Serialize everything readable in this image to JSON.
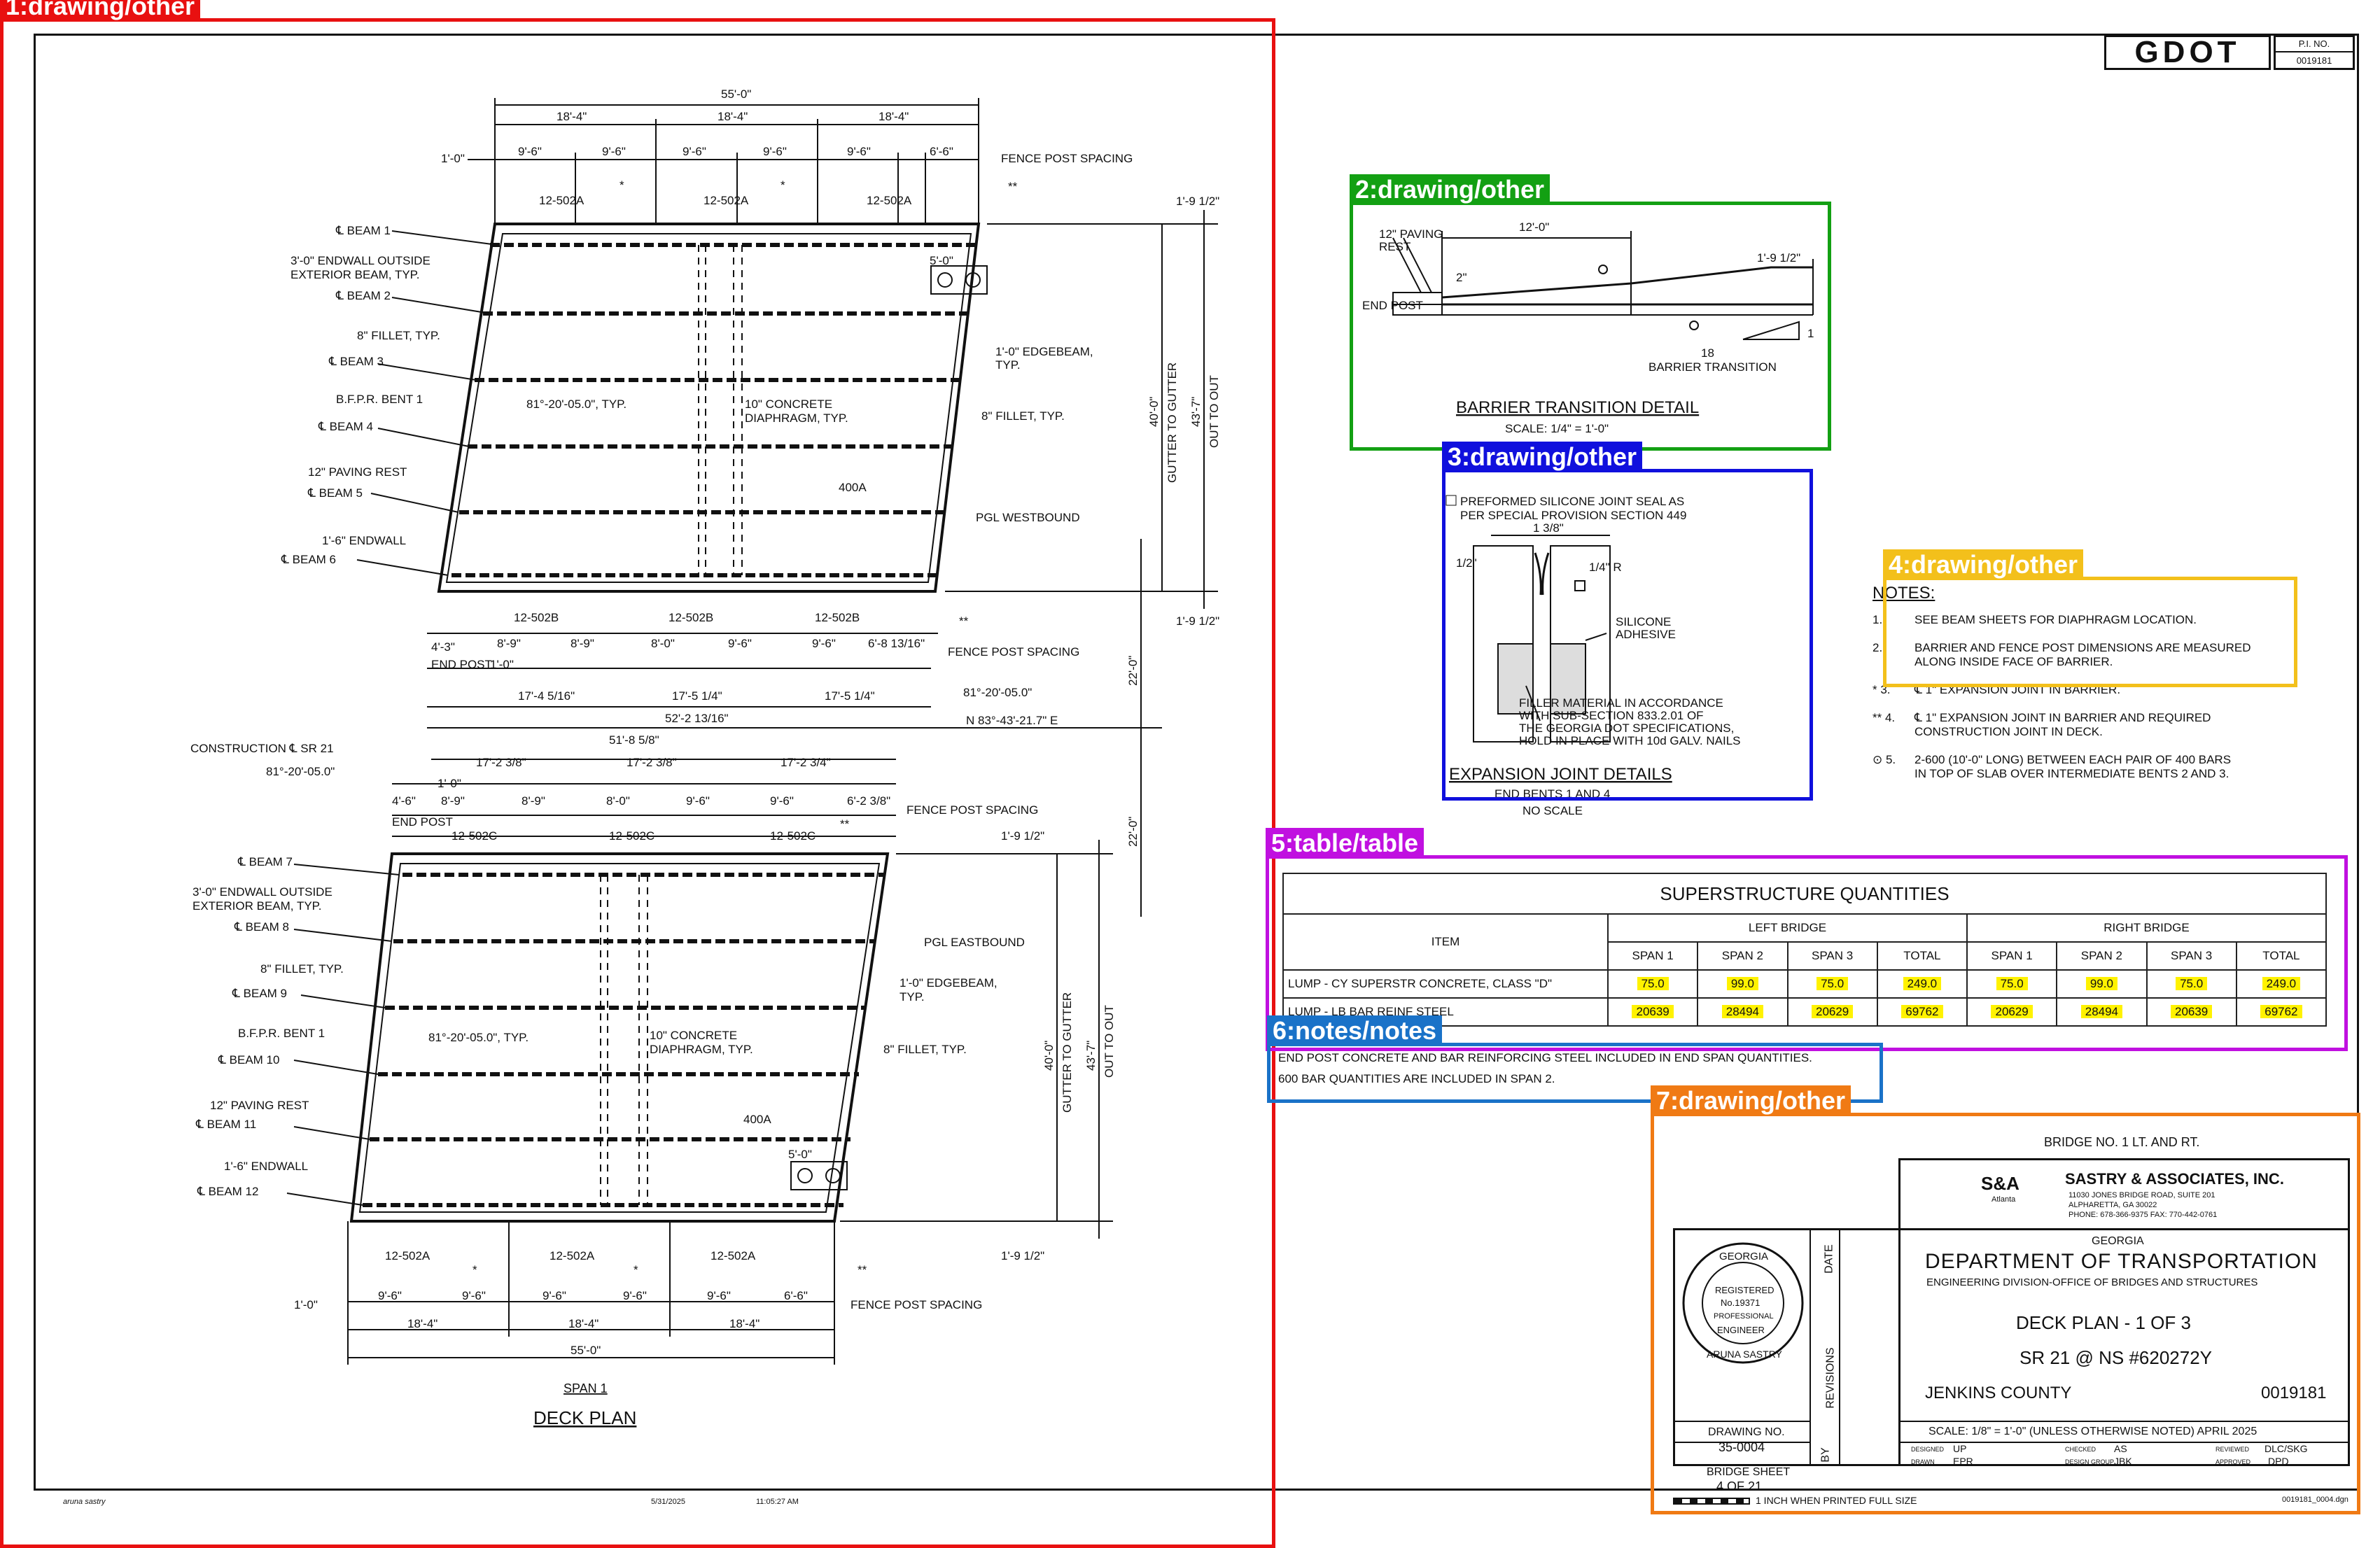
{
  "header": {
    "logo": "GDOT",
    "pi_label": "P.I. NO.",
    "pi_value": "0019181"
  },
  "annotations": [
    {
      "label": "1:drawing/other",
      "color": "#e81010"
    },
    {
      "label": "2:drawing/other",
      "color": "#13a013"
    },
    {
      "label": "3:drawing/other",
      "color": "#1010dd"
    },
    {
      "label": "4:drawing/other",
      "color": "#f3c01b"
    },
    {
      "label": "5:table/table",
      "color": "#c010e0"
    },
    {
      "label": "6:notes/notes",
      "color": "#1a72c8"
    },
    {
      "label": "7:drawing/other",
      "color": "#f07a14"
    }
  ],
  "deck_plan": {
    "title": "DECK PLAN",
    "span_label": "SPAN 1",
    "top_dims": {
      "overall": "55'-0\"",
      "segments": [
        "18'-4\"",
        "18'-4\"",
        "18'-4\""
      ],
      "posts": [
        "1'-0\"",
        "9'-6\"",
        "9'-6\"",
        "9'-6\"",
        "9'-6\"",
        "9'-6\"",
        "6'-6\""
      ],
      "fence_post_spacing": "FENCE POST SPACING",
      "bars": [
        "12-502A",
        "12-502A",
        "12-502A"
      ],
      "star": "*",
      "dstar": "**"
    },
    "left_bridge_labels": [
      "℄ BEAM 1",
      "3'-0\" ENDWALL OUTSIDE",
      "EXTERIOR BEAM, TYP.",
      "℄ BEAM 2",
      "8\" FILLET, TYP.",
      "℄ BEAM 3",
      "B.F.P.R. BENT 1",
      "℄ BEAM 4",
      "12\" PAVING REST",
      "℄ BEAM 5",
      "1'-6\" ENDWALL",
      "℄ BEAM 6"
    ],
    "right_bridge_labels": [
      "℄ BEAM 7",
      "3'-0\" ENDWALL OUTSIDE",
      "EXTERIOR BEAM, TYP.",
      "℄ BEAM 8",
      "8\" FILLET, TYP.",
      "℄ BEAM 9",
      "B.F.P.R. BENT 1",
      "℄ BEAM 10",
      "12\" PAVING REST",
      "℄ BEAM 11",
      "1'-6\" ENDWALL",
      "℄ BEAM 12"
    ],
    "inner_labels": [
      "81°-20'-05.0\", TYP.",
      "10\" CONCRETE",
      "DIAPHRAGM, TYP.",
      "400A",
      "1'-0\" EDGEBEAM,",
      "TYP.",
      "8\" FILLET, TYP."
    ],
    "right_dims": {
      "gutter": "40'-0\"",
      "gutter_label": "GUTTER TO GUTTER",
      "out": "43'-7\"",
      "out_label": "OUT TO OUT",
      "edge": "1'-9 1/2\"",
      "gap": "22'-0\""
    },
    "pgl_wb": "PGL WESTBOUND",
    "pgl_eb": "PGL EASTBOUND",
    "middle": {
      "bars_b": [
        "12-502B",
        "12-502B",
        "12-502B"
      ],
      "bars_c": [
        "12-502C",
        "12-502C",
        "12-502C"
      ],
      "end_post": "END POST",
      "lower_posts_wb": [
        "4'-3\"",
        "8'-9\"",
        "8'-9\"",
        "8'-0\"",
        "9'-6\"",
        "9'-6\"",
        "6'-8 13/16\""
      ],
      "lower_posts_eb": [
        "4'-6\"",
        "8'-9\"",
        "8'-9\"",
        "8'-0\"",
        "9'-6\"",
        "9'-6\"",
        "6'-2 3/8\""
      ],
      "spans_wb": [
        "17'-4 5/16\"",
        "17'-5 1/4\"",
        "17'-5 1/4\""
      ],
      "total_wb": "52'-2 13/16\"",
      "spans_eb": [
        "17'-2 3/8\"",
        "17'-2 3/8\"",
        "17'-2 3/4\""
      ],
      "total_eb": "51'-8 5/8\"",
      "one_foot": "1'-0\"",
      "skew": "81°-20'-05.0\"",
      "bearing": "N 83°-43'-21.7\" E",
      "construction": "CONSTRUCTION ℄ SR 21",
      "skew2": "81°-20'-05.0\""
    },
    "bottom_dims": {
      "overall": "55'-0\"",
      "segments": [
        "18'-4\"",
        "18'-4\"",
        "18'-4\""
      ],
      "posts": [
        "1'-0\"",
        "9'-6\"",
        "9'-6\"",
        "9'-6\"",
        "9'-6\"",
        "9'-6\"",
        "6'-6\""
      ],
      "bars": [
        "12-502A",
        "12-502A",
        "12-502A"
      ]
    },
    "marker": "5'-0\""
  },
  "barrier_detail": {
    "title": "BARRIER TRANSITION DETAIL",
    "scale": "SCALE: 1/4\" = 1'-0\"",
    "labels": [
      "12\" PAVING",
      "REST",
      "END POST",
      "2\"",
      "12'-0\"",
      "1'-9 1/2\"",
      "18",
      "1",
      "BARRIER TRANSITION"
    ]
  },
  "expansion_detail": {
    "title": "EXPANSION JOINT DETAILS",
    "sub": "END BENTS 1 AND 4",
    "scale": "NO SCALE",
    "note1": [
      "PREFORMED SILICONE JOINT SEAL AS",
      "PER SPECIAL PROVISION SECTION 449"
    ],
    "dims": [
      "1 3/8\"",
      "1/4\" R",
      "1/2\""
    ],
    "silicone": [
      "SILICONE",
      "ADHESIVE"
    ],
    "filler": [
      "FILLER MATERIAL IN ACCORDANCE",
      "WITH SUB-SECTION 833.2.01 OF",
      "THE GEORGIA DOT SPECIFICATIONS,",
      "HOLD IN PLACE WITH 10d GALV. NAILS"
    ]
  },
  "notes": {
    "title": "NOTES:",
    "items": [
      {
        "mark": "1.",
        "lines": [
          "SEE BEAM SHEETS FOR DIAPHRAGM LOCATION."
        ]
      },
      {
        "mark": "2.",
        "lines": [
          "BARRIER AND FENCE POST DIMENSIONS ARE MEASURED",
          "ALONG INSIDE FACE OF BARRIER."
        ]
      },
      {
        "mark": "* 3.",
        "lines": [
          "℄ 1\" EXPANSION JOINT IN BARRIER."
        ]
      },
      {
        "mark": "** 4.",
        "lines": [
          "℄ 1\" EXPANSION JOINT IN BARRIER AND REQUIRED",
          "CONSTRUCTION JOINT IN DECK."
        ]
      },
      {
        "mark": "⊙ 5.",
        "lines": [
          "2-600 (10'-0\" LONG) BETWEEN EACH PAIR OF 400 BARS",
          "IN TOP OF SLAB OVER INTERMEDIATE BENTS 2 AND 3."
        ]
      }
    ]
  },
  "quantities": {
    "title": "SUPERSTRUCTURE QUANTITIES",
    "item_header": "ITEM",
    "left_header": "LEFT BRIDGE",
    "right_header": "RIGHT BRIDGE",
    "cols": [
      "SPAN 1",
      "SPAN 2",
      "SPAN 3",
      "TOTAL",
      "SPAN 1",
      "SPAN 2",
      "SPAN 3",
      "TOTAL"
    ],
    "rows": [
      {
        "item": "LUMP - CY SUPERSTR CONCRETE, CLASS \"D\"",
        "values": [
          "75.0",
          "99.0",
          "75.0",
          "249.0",
          "75.0",
          "99.0",
          "75.0",
          "249.0"
        ]
      },
      {
        "item": "LUMP - LB BAR REINF STEEL",
        "values": [
          "20639",
          "28494",
          "20629",
          "69762",
          "20629",
          "28494",
          "20639",
          "69762"
        ]
      }
    ]
  },
  "footnotes": [
    "END POST CONCRETE AND BAR REINFORCING STEEL INCLUDED IN END SPAN QUANTITIES.",
    "600 BAR QUANTITIES ARE INCLUDED IN SPAN 2."
  ],
  "title_block": {
    "bridge": "BRIDGE NO. 1 LT. AND RT.",
    "firm_logo": "S&A",
    "firm_logo_sub": "Atlanta",
    "firm": "SASTRY & ASSOCIATES, INC.",
    "firm_addr": [
      "11030 JONES BRIDGE ROAD, SUITE 201",
      "ALPHARETTA, GA 30022",
      "PHONE: 678-366-9375    FAX: 770-442-0761"
    ],
    "state": "GEORGIA",
    "dept": "DEPARTMENT OF TRANSPORTATION",
    "division": "ENGINEERING DIVISION-OFFICE OF BRIDGES AND STRUCTURES",
    "sheet_title": "DECK PLAN - 1 OF 3",
    "route": "SR 21 @ NS #620272Y",
    "county": "JENKINS COUNTY",
    "pi": "0019181",
    "scale": "SCALE: 1/8\" = 1'-0\" (UNLESS OTHERWISE NOTED)  APRIL 2025",
    "drawing_no_label": "DRAWING NO.",
    "drawing_no": "35-0004",
    "bridge_sheet_label": "BRIDGE SHEET",
    "bridge_sheet": "4  OF  21",
    "date_label": "DATE",
    "revisions_label": "REVISIONS",
    "by_label": "BY",
    "seal": {
      "top": "GEORGIA",
      "reg": "REGISTERED",
      "no": "No.19371",
      "prof": "PROFESSIONAL",
      "eng": "ENGINEER",
      "name": "ARUNA SASTRY"
    },
    "designed_label": "DESIGNED",
    "designed": "UP",
    "checked_label": "CHECKED",
    "checked": "AS",
    "reviewed_label": "REVIEWED",
    "reviewed": "DLC/SKG",
    "drawn_label": "DRAWN",
    "drawn": "EPR",
    "design_group_label": "DESIGN GROUP",
    "design_group": "JBK",
    "approved_label": "APPROVED",
    "approved": "DPD",
    "scale_bar": "1 INCH WHEN PRINTED FULL SIZE",
    "file": "0019181_0004.dgn"
  },
  "footer": {
    "user": "aruna sastry",
    "date": "5/31/2025",
    "time": "11:05:27 AM"
  }
}
